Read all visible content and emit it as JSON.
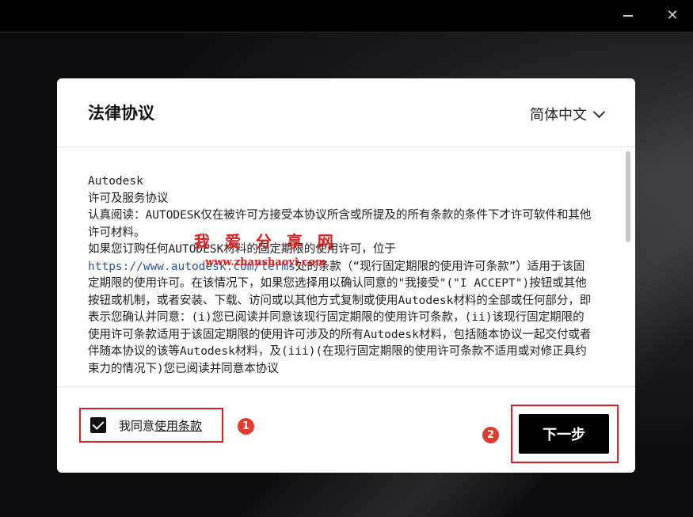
{
  "window": {
    "minimize_label": "",
    "close_label": "✕"
  },
  "dialog": {
    "title": "法律协议",
    "language": "简体中文",
    "content": {
      "lines": [
        "Autodesk",
        "许可及服务协议",
        "认真阅读：AUTODESK仅在被许可方接受本协议所含或所提及的所有条款的条件下才许可软件和其他许可材料。",
        "如果您订购任何AUTODESK材料的固定期限的使用许可，位于"
      ],
      "link": "https://www.autodesk.com/terms",
      "after_link": "处的条款（“现行固定期限的使用许可条款”）适用于该固定期限的使用许可。在该情况下，如果您选择用以确认同意的\"我接受\"(\"I ACCEPT\")按钮或其他按钮或机制，或者安装、下载、访问或以其他方式复制或使用Autodesk材料的全部或任何部分，即表示您确认并同意：(i)您已阅读并同意该现行固定期限的使用许可条款，(ii)该现行固定期限的使用许可条款适用于该固定期限的使用许可涉及的所有Autodesk材料，包括随本协议一起交付或者伴随本协议的该等Autodesk材料，及(iii)(在现行固定期限的使用许可条款不适用或对修正具约束力的情况下)您已阅读并同意本协议"
    },
    "agree": {
      "prefix": "我同意",
      "link_text": "使用条款",
      "checked": true
    },
    "next_button": "下一步"
  },
  "annotations": {
    "badge_1": "1",
    "badge_2": "2",
    "highlight_color": "#e02020"
  },
  "watermark": {
    "text": "我 爱 分 享 网",
    "url": "www.zhanshaoyi.com"
  }
}
